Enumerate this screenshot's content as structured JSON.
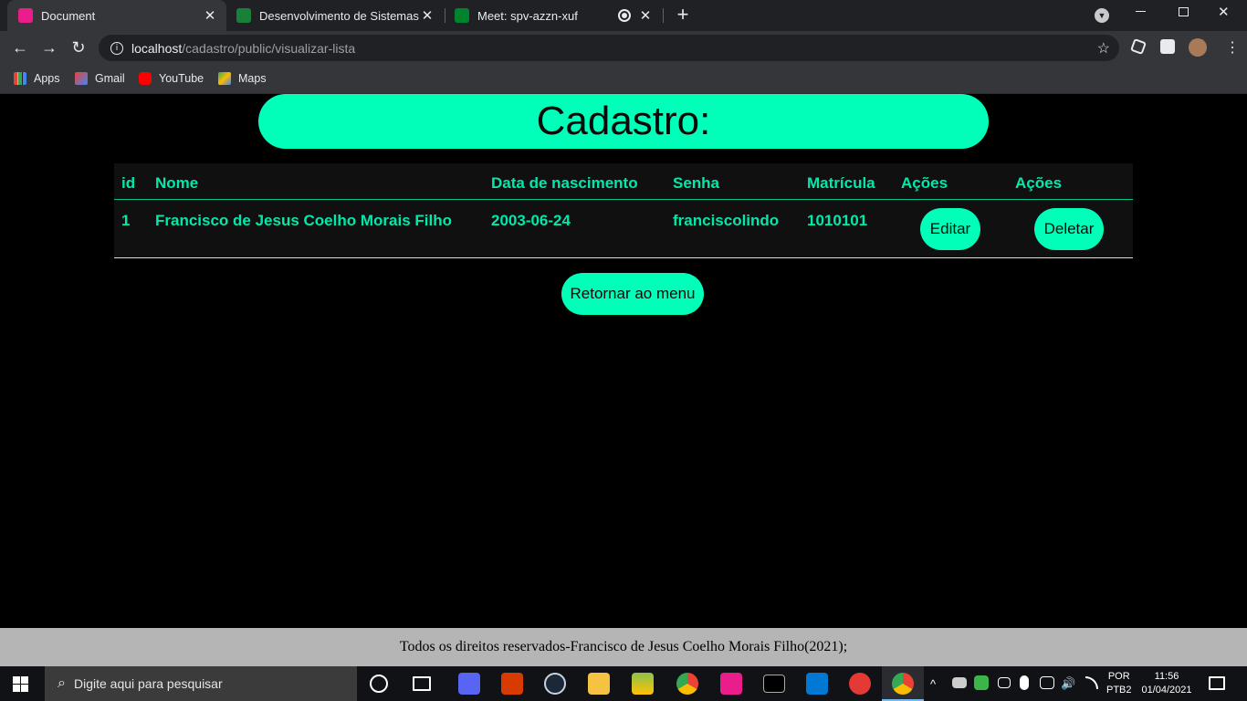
{
  "browser": {
    "tabs": [
      {
        "title": "Document",
        "active": true
      },
      {
        "title": "Desenvolvimento de Sistemas W",
        "active": false
      },
      {
        "title": "Meet: spv-azzn-xuf",
        "active": false
      }
    ],
    "new_tab_label": "+",
    "url_host": "localhost",
    "url_path": "/cadastro/public/visualizar-lista",
    "bookmarks": [
      {
        "label": "Apps",
        "icon": "apps-grid-icon"
      },
      {
        "label": "Gmail",
        "icon": "gmail-icon"
      },
      {
        "label": "YouTube",
        "icon": "youtube-icon"
      },
      {
        "label": "Maps",
        "icon": "maps-icon"
      }
    ]
  },
  "page": {
    "heading": "Cadastro:",
    "table": {
      "headers": [
        "id",
        "Nome",
        "Data de nascimento",
        "Senha",
        "Matrícula",
        "Ações",
        "Ações"
      ],
      "rows": [
        {
          "id": "1",
          "nome": "Francisco de Jesus Coelho Morais Filho",
          "nascimento": "2003-06-24",
          "senha": "franciscolindo",
          "matricula": "1010101",
          "edit_label": "Editar",
          "delete_label": "Deletar"
        }
      ]
    },
    "back_button": "Retornar ao menu",
    "footer": "Todos os direitos reservados-Francisco de Jesus Coelho Morais Filho(2021);"
  },
  "taskbar": {
    "search_placeholder": "Digite aqui para pesquisar",
    "language": "POR",
    "layout": "PTB2",
    "time": "11:56",
    "date": "01/04/2021"
  },
  "colors": {
    "accent": "#00ffb8",
    "accent_text": "#00e9aa",
    "background": "#000000",
    "footer": "#b5b5b5"
  }
}
